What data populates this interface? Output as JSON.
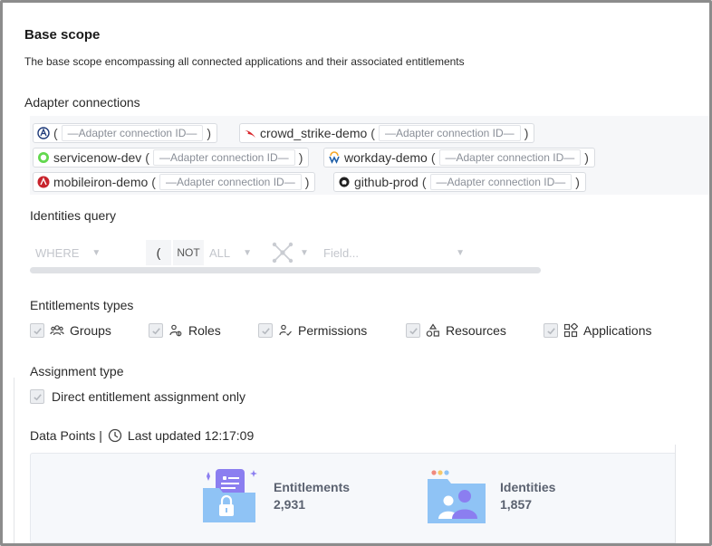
{
  "header": {
    "title": "Base scope",
    "subtitle": "The base scope encompassing all connected applications and their associated entitlements"
  },
  "adapters": {
    "label": "Adapter connections",
    "placeholder": "—Adapter connection ID—",
    "open_paren": "(",
    "close_paren": ")",
    "items": [
      {
        "name": "",
        "icon": "eagle-logo-icon",
        "color": "#1f3b7a"
      },
      {
        "name": "crowd_strike-demo",
        "icon": "crowdstrike-falcon-icon",
        "color": "#d9262b"
      },
      {
        "name": "servicenow-dev",
        "icon": "servicenow-icon",
        "color": "#62d84e"
      },
      {
        "name": "workday-demo",
        "icon": "workday-icon",
        "color": "#f5a623"
      },
      {
        "name": "mobileiron-demo",
        "icon": "mobileiron-icon",
        "color": "#c8232c"
      },
      {
        "name": "github-prod",
        "icon": "github-icon",
        "color": "#222222"
      }
    ]
  },
  "query": {
    "label": "Identities query",
    "where": "WHERE",
    "paren": "(",
    "not": "NOT",
    "all": "ALL",
    "field_placeholder": "Field..."
  },
  "entitlements": {
    "label": "Entitlements types",
    "items": [
      {
        "label": "Groups",
        "icon": "groups-icon",
        "checked": true
      },
      {
        "label": "Roles",
        "icon": "roles-icon",
        "checked": true
      },
      {
        "label": "Permissions",
        "icon": "permissions-icon",
        "checked": true
      },
      {
        "label": "Resources",
        "icon": "resources-icon",
        "checked": true
      },
      {
        "label": "Applications",
        "icon": "applications-icon",
        "checked": true
      }
    ]
  },
  "assignment": {
    "label": "Assignment type",
    "option": "Direct entitlement assignment only",
    "checked": true
  },
  "data_points": {
    "label": "Data Points |",
    "updated": "Last updated 12:17:09",
    "stats": [
      {
        "label": "Entitlements",
        "value": "2,931",
        "icon": "entitlements-folder-icon"
      },
      {
        "label": "Identities",
        "value": "1,857",
        "icon": "identities-folder-icon"
      }
    ]
  },
  "colors": {
    "accent_blue": "#8fc3f5",
    "accent_purple": "#8b7ef0",
    "checkbox_disabled": "#eceef1"
  }
}
